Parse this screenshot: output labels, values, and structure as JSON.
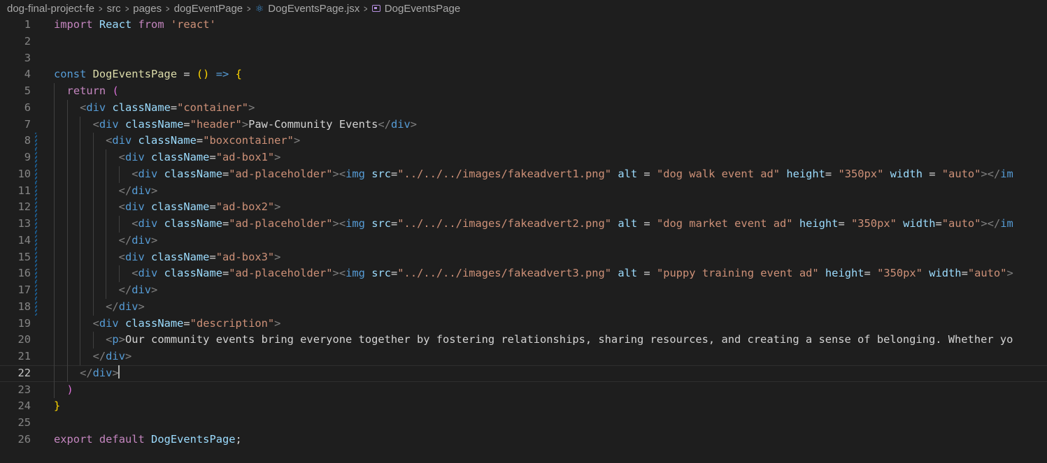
{
  "breadcrumb": {
    "items": [
      "dog-final-project-fe",
      "src",
      "pages",
      "dogEventPage",
      "DogEventsPage.jsx",
      "DogEventsPage"
    ],
    "file_icon": "react-icon",
    "symbol_icon": "symbol-variable-icon"
  },
  "editor": {
    "current_line": 22,
    "lines": [
      {
        "num": "1",
        "tokens": [
          [
            "import",
            "k-purple"
          ],
          [
            " ",
            "k-text"
          ],
          [
            "React",
            "k-var"
          ],
          [
            " ",
            "k-text"
          ],
          [
            "from",
            "k-purple"
          ],
          [
            " ",
            "k-text"
          ],
          [
            "'react'",
            "k-str"
          ]
        ]
      },
      {
        "num": "2",
        "tokens": []
      },
      {
        "num": "3",
        "tokens": []
      },
      {
        "num": "4",
        "tokens": [
          [
            "const",
            "k-blue"
          ],
          [
            " ",
            "k-text"
          ],
          [
            "DogEventsPage",
            "k-fn"
          ],
          [
            " = ",
            "k-text"
          ],
          [
            "()",
            "k-gold"
          ],
          [
            " ",
            "k-text"
          ],
          [
            "=>",
            "k-blue"
          ],
          [
            " ",
            "k-text"
          ],
          [
            "{",
            "k-gold"
          ]
        ]
      },
      {
        "num": "5",
        "tokens": [
          [
            "  ",
            "k-text"
          ],
          [
            "return",
            "k-purple"
          ],
          [
            " ",
            "k-text"
          ],
          [
            "(",
            "k-pink"
          ]
        ]
      },
      {
        "num": "6",
        "tokens": [
          [
            "    ",
            "k-text"
          ],
          [
            "<",
            "k-punc"
          ],
          [
            "div",
            "k-tag"
          ],
          [
            " ",
            "k-text"
          ],
          [
            "className",
            "k-attr"
          ],
          [
            "=",
            "k-text"
          ],
          [
            "\"container\"",
            "k-str"
          ],
          [
            ">",
            "k-punc"
          ]
        ]
      },
      {
        "num": "7",
        "tokens": [
          [
            "      ",
            "k-text"
          ],
          [
            "<",
            "k-punc"
          ],
          [
            "div",
            "k-tag"
          ],
          [
            " ",
            "k-text"
          ],
          [
            "className",
            "k-attr"
          ],
          [
            "=",
            "k-text"
          ],
          [
            "\"header\"",
            "k-str"
          ],
          [
            ">",
            "k-punc"
          ],
          [
            "Paw-Community Events",
            "k-text"
          ],
          [
            "</",
            "k-punc"
          ],
          [
            "div",
            "k-tag"
          ],
          [
            ">",
            "k-punc"
          ]
        ]
      },
      {
        "num": "8",
        "tokens": [
          [
            "        ",
            "k-text"
          ],
          [
            "<",
            "k-punc"
          ],
          [
            "div",
            "k-tag"
          ],
          [
            " ",
            "k-text"
          ],
          [
            "className",
            "k-attr"
          ],
          [
            "=",
            "k-text"
          ],
          [
            "\"boxcontainer\"",
            "k-str"
          ],
          [
            ">",
            "k-punc"
          ]
        ]
      },
      {
        "num": "9",
        "tokens": [
          [
            "          ",
            "k-text"
          ],
          [
            "<",
            "k-punc"
          ],
          [
            "div",
            "k-tag"
          ],
          [
            " ",
            "k-text"
          ],
          [
            "className",
            "k-attr"
          ],
          [
            "=",
            "k-text"
          ],
          [
            "\"ad-box1\"",
            "k-str"
          ],
          [
            ">",
            "k-punc"
          ]
        ]
      },
      {
        "num": "10",
        "tokens": [
          [
            "            ",
            "k-text"
          ],
          [
            "<",
            "k-punc"
          ],
          [
            "div",
            "k-tag"
          ],
          [
            " ",
            "k-text"
          ],
          [
            "className",
            "k-attr"
          ],
          [
            "=",
            "k-text"
          ],
          [
            "\"ad-placeholder\"",
            "k-str"
          ],
          [
            ">",
            "k-punc"
          ],
          [
            "<",
            "k-punc"
          ],
          [
            "img",
            "k-tag"
          ],
          [
            " ",
            "k-text"
          ],
          [
            "src",
            "k-attr"
          ],
          [
            "=",
            "k-text"
          ],
          [
            "\"../../../images/fakeadvert1.png\"",
            "k-str"
          ],
          [
            " ",
            "k-text"
          ],
          [
            "alt",
            "k-attr"
          ],
          [
            " = ",
            "k-text"
          ],
          [
            "\"dog walk event ad\"",
            "k-str"
          ],
          [
            " ",
            "k-text"
          ],
          [
            "height",
            "k-attr"
          ],
          [
            "= ",
            "k-text"
          ],
          [
            "\"350px\"",
            "k-str"
          ],
          [
            " ",
            "k-text"
          ],
          [
            "width",
            "k-attr"
          ],
          [
            " = ",
            "k-text"
          ],
          [
            "\"auto\"",
            "k-str"
          ],
          [
            ">",
            "k-punc"
          ],
          [
            "</",
            "k-punc"
          ],
          [
            "im",
            "k-tag"
          ]
        ]
      },
      {
        "num": "11",
        "tokens": [
          [
            "          ",
            "k-text"
          ],
          [
            "</",
            "k-punc"
          ],
          [
            "div",
            "k-tag"
          ],
          [
            ">",
            "k-punc"
          ]
        ]
      },
      {
        "num": "12",
        "tokens": [
          [
            "          ",
            "k-text"
          ],
          [
            "<",
            "k-punc"
          ],
          [
            "div",
            "k-tag"
          ],
          [
            " ",
            "k-text"
          ],
          [
            "className",
            "k-attr"
          ],
          [
            "=",
            "k-text"
          ],
          [
            "\"ad-box2\"",
            "k-str"
          ],
          [
            ">",
            "k-punc"
          ]
        ]
      },
      {
        "num": "13",
        "tokens": [
          [
            "            ",
            "k-text"
          ],
          [
            "<",
            "k-punc"
          ],
          [
            "div",
            "k-tag"
          ],
          [
            " ",
            "k-text"
          ],
          [
            "className",
            "k-attr"
          ],
          [
            "=",
            "k-text"
          ],
          [
            "\"ad-placeholder\"",
            "k-str"
          ],
          [
            ">",
            "k-punc"
          ],
          [
            "<",
            "k-punc"
          ],
          [
            "img",
            "k-tag"
          ],
          [
            " ",
            "k-text"
          ],
          [
            "src",
            "k-attr"
          ],
          [
            "=",
            "k-text"
          ],
          [
            "\"../../../images/fakeadvert2.png\"",
            "k-str"
          ],
          [
            " ",
            "k-text"
          ],
          [
            "alt",
            "k-attr"
          ],
          [
            " = ",
            "k-text"
          ],
          [
            "\"dog market event ad\"",
            "k-str"
          ],
          [
            " ",
            "k-text"
          ],
          [
            "height",
            "k-attr"
          ],
          [
            "= ",
            "k-text"
          ],
          [
            "\"350px\"",
            "k-str"
          ],
          [
            " ",
            "k-text"
          ],
          [
            "width",
            "k-attr"
          ],
          [
            "=",
            "k-text"
          ],
          [
            "\"auto\"",
            "k-str"
          ],
          [
            ">",
            "k-punc"
          ],
          [
            "</",
            "k-punc"
          ],
          [
            "im",
            "k-tag"
          ]
        ]
      },
      {
        "num": "14",
        "tokens": [
          [
            "          ",
            "k-text"
          ],
          [
            "</",
            "k-punc"
          ],
          [
            "div",
            "k-tag"
          ],
          [
            ">",
            "k-punc"
          ]
        ]
      },
      {
        "num": "15",
        "tokens": [
          [
            "          ",
            "k-text"
          ],
          [
            "<",
            "k-punc"
          ],
          [
            "div",
            "k-tag"
          ],
          [
            " ",
            "k-text"
          ],
          [
            "className",
            "k-attr"
          ],
          [
            "=",
            "k-text"
          ],
          [
            "\"ad-box3\"",
            "k-str"
          ],
          [
            ">",
            "k-punc"
          ]
        ]
      },
      {
        "num": "16",
        "tokens": [
          [
            "            ",
            "k-text"
          ],
          [
            "<",
            "k-punc"
          ],
          [
            "div",
            "k-tag"
          ],
          [
            " ",
            "k-text"
          ],
          [
            "className",
            "k-attr"
          ],
          [
            "=",
            "k-text"
          ],
          [
            "\"ad-placeholder\"",
            "k-str"
          ],
          [
            ">",
            "k-punc"
          ],
          [
            "<",
            "k-punc"
          ],
          [
            "img",
            "k-tag"
          ],
          [
            " ",
            "k-text"
          ],
          [
            "src",
            "k-attr"
          ],
          [
            "=",
            "k-text"
          ],
          [
            "\"../../../images/fakeadvert3.png\"",
            "k-str"
          ],
          [
            " ",
            "k-text"
          ],
          [
            "alt",
            "k-attr"
          ],
          [
            " = ",
            "k-text"
          ],
          [
            "\"puppy training event ad\"",
            "k-str"
          ],
          [
            " ",
            "k-text"
          ],
          [
            "height",
            "k-attr"
          ],
          [
            "= ",
            "k-text"
          ],
          [
            "\"350px\"",
            "k-str"
          ],
          [
            " ",
            "k-text"
          ],
          [
            "width",
            "k-attr"
          ],
          [
            "=",
            "k-text"
          ],
          [
            "\"auto\"",
            "k-str"
          ],
          [
            ">",
            "k-punc"
          ]
        ]
      },
      {
        "num": "17",
        "tokens": [
          [
            "          ",
            "k-text"
          ],
          [
            "</",
            "k-punc"
          ],
          [
            "div",
            "k-tag"
          ],
          [
            ">",
            "k-punc"
          ]
        ]
      },
      {
        "num": "18",
        "tokens": [
          [
            "        ",
            "k-text"
          ],
          [
            "</",
            "k-punc"
          ],
          [
            "div",
            "k-tag"
          ],
          [
            ">",
            "k-punc"
          ]
        ]
      },
      {
        "num": "19",
        "tokens": [
          [
            "      ",
            "k-text"
          ],
          [
            "<",
            "k-punc"
          ],
          [
            "div",
            "k-tag"
          ],
          [
            " ",
            "k-text"
          ],
          [
            "className",
            "k-attr"
          ],
          [
            "=",
            "k-text"
          ],
          [
            "\"description\"",
            "k-str"
          ],
          [
            ">",
            "k-punc"
          ]
        ]
      },
      {
        "num": "20",
        "tokens": [
          [
            "        ",
            "k-text"
          ],
          [
            "<",
            "k-punc"
          ],
          [
            "p",
            "k-tag"
          ],
          [
            ">",
            "k-punc"
          ],
          [
            "Our community events bring everyone together by fostering relationships, sharing resources, and creating a sense of belonging. Whether yo",
            "k-text"
          ]
        ]
      },
      {
        "num": "21",
        "tokens": [
          [
            "      ",
            "k-text"
          ],
          [
            "</",
            "k-punc"
          ],
          [
            "div",
            "k-tag"
          ],
          [
            ">",
            "k-punc"
          ]
        ]
      },
      {
        "num": "22",
        "tokens": [
          [
            "    ",
            "k-text"
          ],
          [
            "</",
            "k-punc"
          ],
          [
            "div",
            "k-tag"
          ],
          [
            ">",
            "k-punc"
          ]
        ]
      },
      {
        "num": "23",
        "tokens": [
          [
            "  ",
            "k-text"
          ],
          [
            ")",
            "k-pink"
          ]
        ]
      },
      {
        "num": "24",
        "tokens": [
          [
            "}",
            "k-gold"
          ]
        ]
      },
      {
        "num": "25",
        "tokens": []
      },
      {
        "num": "26",
        "tokens": [
          [
            "export",
            "k-purple"
          ],
          [
            " ",
            "k-text"
          ],
          [
            "default",
            "k-purple"
          ],
          [
            " ",
            "k-text"
          ],
          [
            "DogEventsPage",
            "k-var"
          ],
          [
            ";",
            "k-text"
          ]
        ]
      }
    ]
  }
}
